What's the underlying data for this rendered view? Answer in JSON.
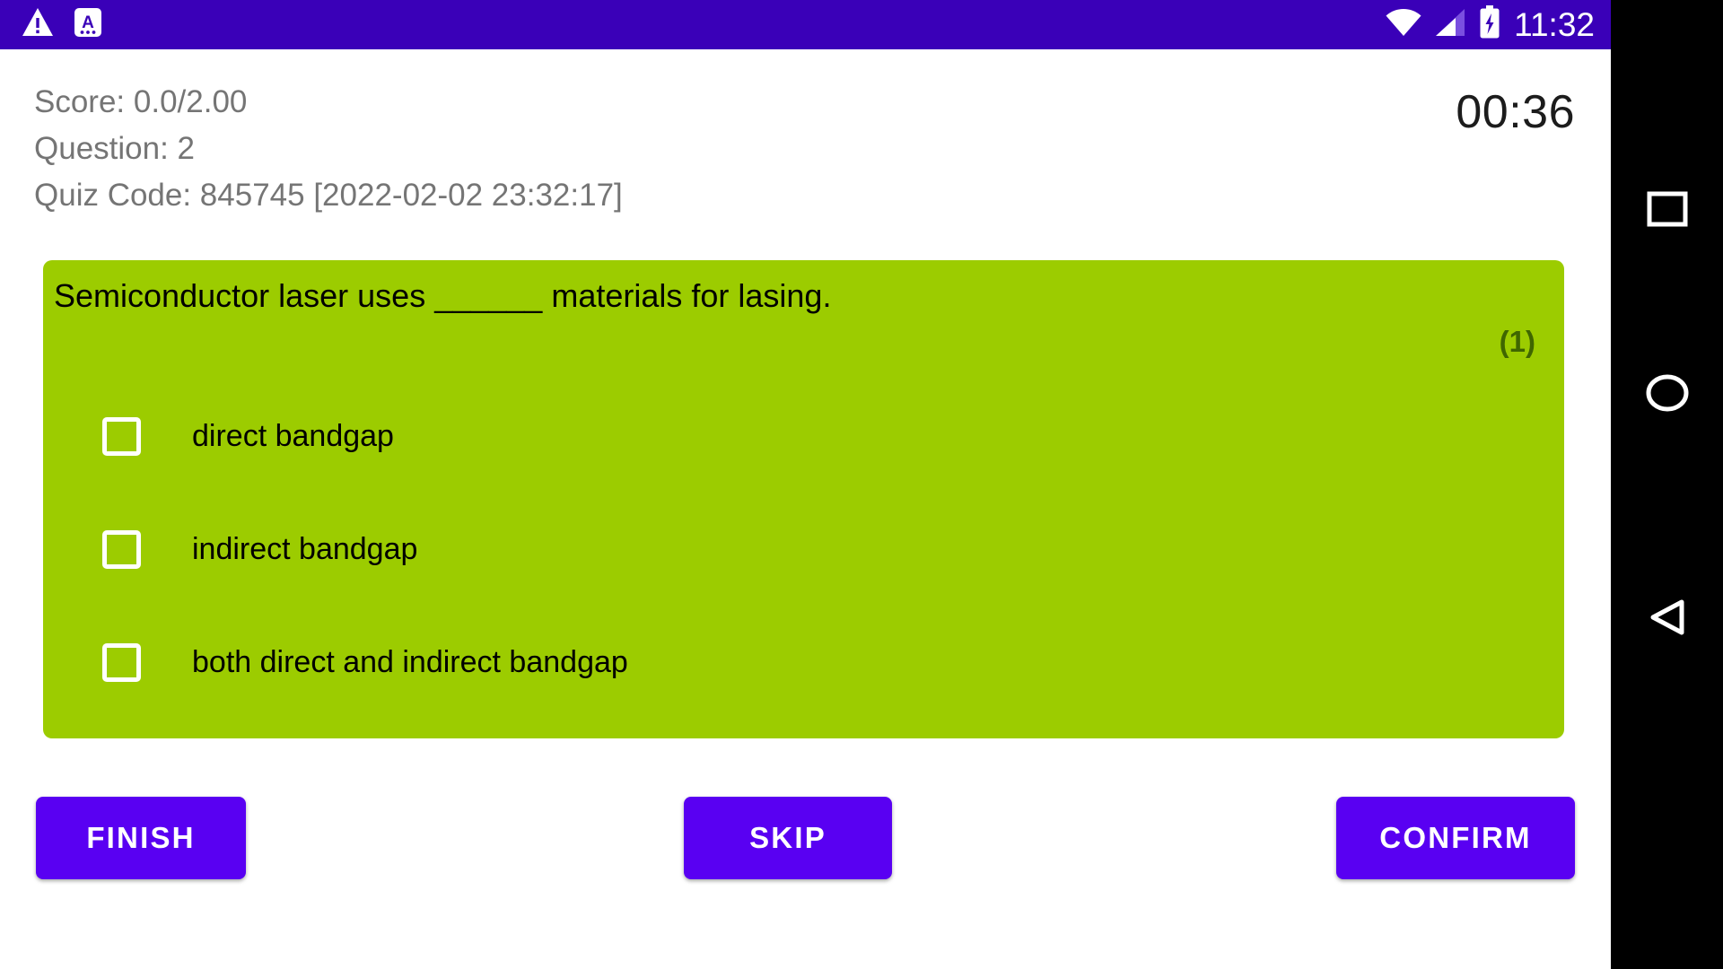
{
  "status_bar": {
    "background_color": "#3A00B8",
    "left_icons": [
      {
        "name": "warning-triangle-icon",
        "glyph": "warning"
      },
      {
        "name": "input-method-a-icon",
        "glyph": "keyboard-a"
      }
    ],
    "right_icons": [
      {
        "name": "wifi-icon",
        "glyph": "wifi"
      },
      {
        "name": "cellular-signal-icon",
        "glyph": "signal"
      },
      {
        "name": "battery-charging-icon",
        "glyph": "battery-charging"
      }
    ],
    "time": "11:32"
  },
  "header": {
    "score_label": "Score: 0.0/2.00",
    "question_label": "Question: 2",
    "quiz_code_label": "Quiz Code: 845745 [2022-02-02 23:32:17]",
    "timer": "00:36",
    "text_color": "#757575",
    "timer_color": "#1C1C1C"
  },
  "question_card": {
    "background_color": "#9CCC00",
    "text": "Semiconductor laser uses ______ materials for lasing.",
    "points": "(1)",
    "points_color": "#3F6600",
    "options": [
      {
        "label": "direct bandgap",
        "checked": false
      },
      {
        "label": "indirect bandgap",
        "checked": false
      },
      {
        "label": "both direct and indirect bandgap",
        "checked": false
      }
    ]
  },
  "actions": {
    "accent_color": "#5900F2",
    "finish_label": "FINISH",
    "skip_label": "SKIP",
    "confirm_label": "CONFIRM"
  },
  "nav_bar": {
    "background_color": "#000000",
    "buttons": [
      {
        "name": "recents-button",
        "glyph": "square"
      },
      {
        "name": "home-button",
        "glyph": "circle"
      },
      {
        "name": "back-button",
        "glyph": "triangle"
      }
    ]
  }
}
